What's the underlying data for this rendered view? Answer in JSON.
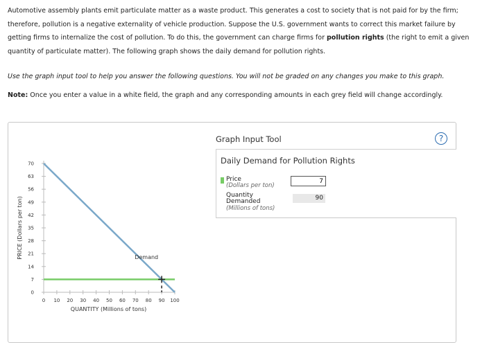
{
  "intro": {
    "p1": "Automotive assembly plants emit particulate matter as a waste product. This generates a cost to society that is not paid for by the firm; therefore, pollution is a negative externality of vehicle production. Suppose the U.S. government wants to correct this market failure by getting firms to internalize the cost of pollution. To do this, the government can charge firms for ",
    "bold": "pollution rights",
    "p2": " (the right to emit a given quantity of particulate matter). The following graph shows the daily demand for pollution rights."
  },
  "instruction": "Use the graph input tool to help you answer the following questions. You will not be graded on any changes you make to this graph.",
  "note": {
    "label": "Note:",
    "text": " Once you enter a value in a white field, the graph and any corresponding amounts in each grey field will change accordingly."
  },
  "tool": {
    "title": "Graph Input Tool",
    "help": "?",
    "panel_title": "Daily Demand for Pollution Rights",
    "price_label": "Price",
    "price_unit": "(Dollars per ton)",
    "price_value": "7",
    "qty_label_1": "Quantity",
    "qty_label_2": "Demanded",
    "qty_unit": "(Millions of tons)",
    "qty_value": "90"
  },
  "colors": {
    "demand": "#7aa8c9",
    "price_line": "#77cc66",
    "axis": "#bbbbbb"
  },
  "chart_data": {
    "type": "line",
    "xlabel": "QUANTITY (Millions of tons)",
    "ylabel": "PRICE (Dollars per ton)",
    "xlim": [
      0,
      100
    ],
    "ylim": [
      0,
      70
    ],
    "xticks": [
      0,
      10,
      20,
      30,
      40,
      50,
      60,
      70,
      80,
      90,
      100
    ],
    "yticks": [
      0,
      7,
      14,
      21,
      28,
      35,
      42,
      49,
      56,
      63,
      70
    ],
    "series": [
      {
        "name": "Demand",
        "x": [
          0,
          100
        ],
        "y": [
          70,
          0
        ]
      }
    ],
    "price_line": 7,
    "marker": {
      "x": 90,
      "y": 7
    }
  }
}
